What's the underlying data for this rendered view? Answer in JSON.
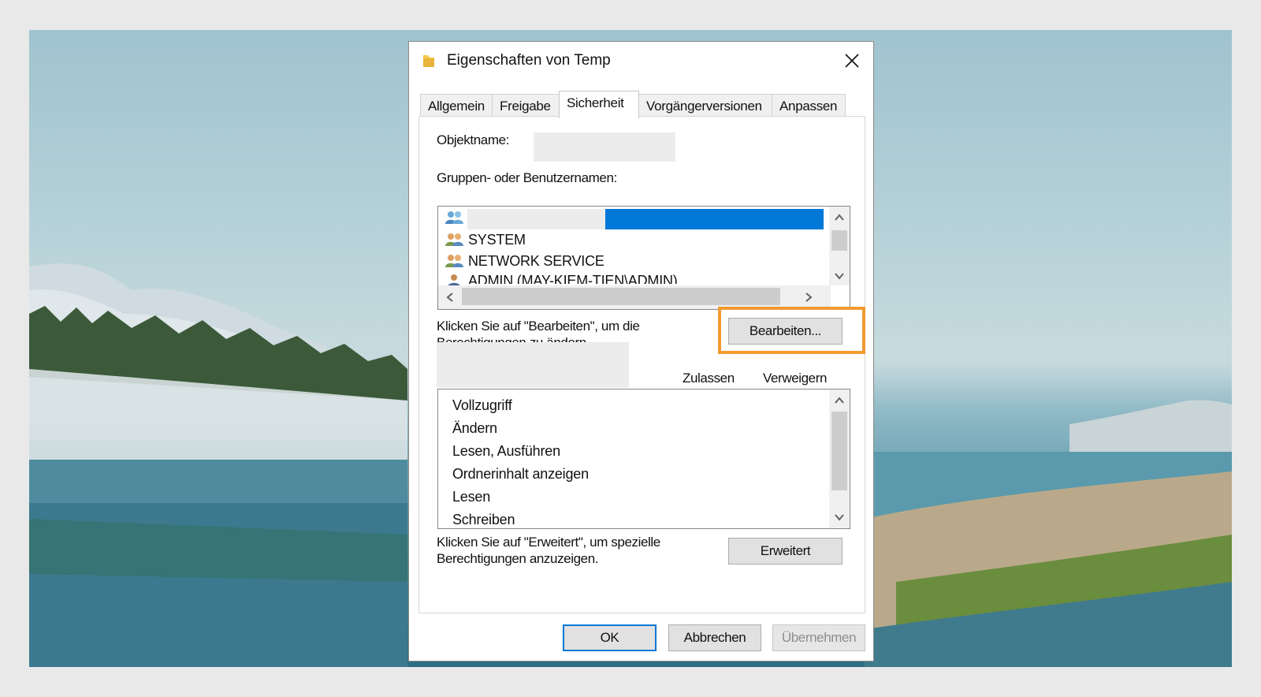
{
  "dialog": {
    "title": "Eigenschaften von Temp",
    "icon": "folder-icon",
    "close_icon": "close-icon"
  },
  "tabs": [
    {
      "label": "Allgemein",
      "active": false
    },
    {
      "label": "Freigabe",
      "active": false
    },
    {
      "label": "Sicherheit",
      "active": true
    },
    {
      "label": "Vorgängerversionen",
      "active": false
    },
    {
      "label": "Anpassen",
      "active": false
    }
  ],
  "security": {
    "object_name_label": "Objektname:",
    "object_name_value": "",
    "groups_label": "Gruppen- oder Benutzernamen:",
    "users": [
      {
        "name": "",
        "icon": "user-group-icon",
        "selected": true
      },
      {
        "name": "SYSTEM",
        "icon": "user-group-icon",
        "selected": false
      },
      {
        "name": "NETWORK SERVICE",
        "icon": "user-group-icon",
        "selected": false
      },
      {
        "name": "ADMIN (MAY-KIEM-TIEN\\ADMIN)",
        "icon": "user-icon",
        "selected": false
      }
    ],
    "edit_hint_line1": "Klicken Sie auf \"Bearbeiten\", um die",
    "edit_hint_line2": "Berechtigungen zu ändern.",
    "edit_button": "Bearbeiten...",
    "permissions_for_label": "",
    "allow_header": "Zulassen",
    "deny_header": "Verweigern",
    "permissions": [
      "Vollzugriff",
      "Ändern",
      "Lesen, Ausführen",
      "Ordnerinhalt anzeigen",
      "Lesen",
      "Schreiben"
    ],
    "advanced_hint_line1": "Klicken Sie auf \"Erweitert\", um spezielle",
    "advanced_hint_line2": "Berechtigungen anzuzeigen.",
    "advanced_button": "Erweitert"
  },
  "footer": {
    "ok": "OK",
    "cancel": "Abbrechen",
    "apply": "Übernehmen"
  },
  "colors": {
    "selection": "#0078d7",
    "highlight": "#f39a30"
  }
}
